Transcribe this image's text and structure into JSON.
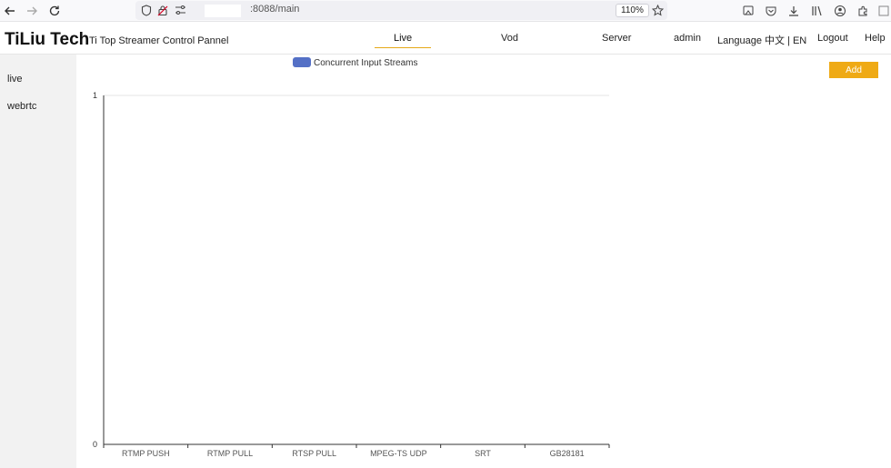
{
  "browser": {
    "url_suffix": ":8088/main",
    "zoom": "110%"
  },
  "header": {
    "brand": "TiLiu Tech",
    "subtitle": "Ti Top Streamer Control Pannel",
    "nav": {
      "live": "Live",
      "vod": "Vod",
      "server": "Server",
      "user": "admin",
      "language": "Language 中文 | EN",
      "logout": "Logout",
      "help": "Help"
    }
  },
  "sidebar": {
    "items": [
      {
        "label": "live"
      },
      {
        "label": "webrtc"
      }
    ]
  },
  "main": {
    "add_label": "Add"
  },
  "chart_data": {
    "type": "bar",
    "legend": "Concurrent Input Streams",
    "legend_position": "top-center",
    "legend_color": "#5470c6",
    "categories": [
      "RTMP PUSH",
      "RTMP PULL",
      "RTSP PULL",
      "MPEG-TS UDP",
      "SRT",
      "GB28181"
    ],
    "series": [
      {
        "name": "Concurrent Input Streams",
        "values": [
          0,
          0,
          0,
          0,
          0,
          0
        ]
      }
    ],
    "ylim": [
      0,
      1
    ],
    "yticks": [
      "0",
      "1"
    ],
    "grid": false
  },
  "colors": {
    "accent": "#efaa15",
    "series": "#5470c6"
  }
}
